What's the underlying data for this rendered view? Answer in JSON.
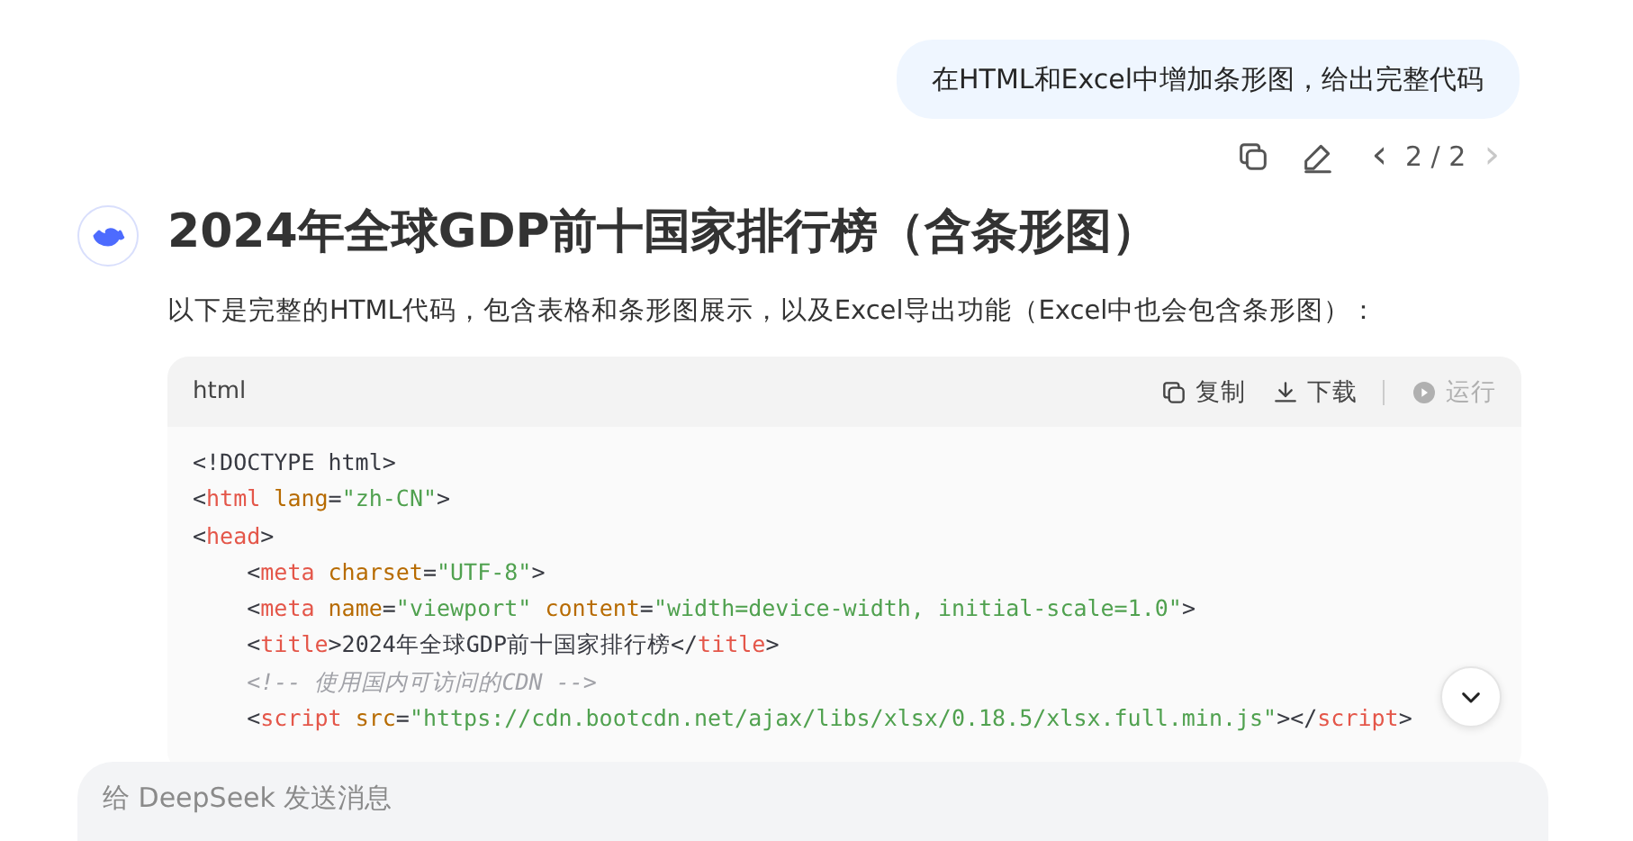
{
  "user_message": {
    "text": "在HTML和Excel中增加条形图，给出完整代码"
  },
  "message_actions": {
    "pager": {
      "prev": "‹",
      "current": "2 / 2",
      "next": "›",
      "prev_disabled": false,
      "next_disabled": true
    }
  },
  "answer": {
    "title": "2024年全球GDP前十国家排行榜（含条形图）",
    "intro": "以下是完整的HTML代码，包含表格和条形图展示，以及Excel导出功能（Excel中也会包含条形图）：",
    "code_block": {
      "language": "html",
      "actions": [
        {
          "kind": "copy",
          "label": "复制",
          "disabled": false
        },
        {
          "kind": "download",
          "label": "下载",
          "disabled": false
        },
        {
          "kind": "run",
          "label": "运行",
          "disabled": true
        }
      ],
      "lines": [
        [
          {
            "kind": "plain",
            "text": "<!DOCTYPE html>"
          }
        ],
        [
          {
            "kind": "plain",
            "text": "<"
          },
          {
            "kind": "tag",
            "text": "html"
          },
          {
            "kind": "attr",
            "text": " lang"
          },
          {
            "kind": "plain",
            "text": "="
          },
          {
            "kind": "string",
            "text": "\"zh-CN\""
          },
          {
            "kind": "plain",
            "text": ">"
          }
        ],
        [
          {
            "kind": "plain",
            "text": "<"
          },
          {
            "kind": "tag",
            "text": "head"
          },
          {
            "kind": "plain",
            "text": ">"
          }
        ],
        [
          {
            "kind": "plain",
            "text": "    <"
          },
          {
            "kind": "tag",
            "text": "meta"
          },
          {
            "kind": "attr",
            "text": " charset"
          },
          {
            "kind": "plain",
            "text": "="
          },
          {
            "kind": "string",
            "text": "\"UTF-8\""
          },
          {
            "kind": "plain",
            "text": ">"
          }
        ],
        [
          {
            "kind": "plain",
            "text": "    <"
          },
          {
            "kind": "tag",
            "text": "meta"
          },
          {
            "kind": "attr",
            "text": " name"
          },
          {
            "kind": "plain",
            "text": "="
          },
          {
            "kind": "string",
            "text": "\"viewport\""
          },
          {
            "kind": "attr",
            "text": " content"
          },
          {
            "kind": "plain",
            "text": "="
          },
          {
            "kind": "string",
            "text": "\"width=device-width, initial-scale=1.0\""
          },
          {
            "kind": "plain",
            "text": ">"
          }
        ],
        [
          {
            "kind": "plain",
            "text": "    <"
          },
          {
            "kind": "tag",
            "text": "title"
          },
          {
            "kind": "plain",
            "text": ">2024年全球GDP前十国家排行榜</"
          },
          {
            "kind": "tag",
            "text": "title"
          },
          {
            "kind": "plain",
            "text": ">"
          }
        ],
        [
          {
            "kind": "comment",
            "text": "    <!-- 使用国内可访问的CDN -->"
          }
        ],
        [
          {
            "kind": "plain",
            "text": "    <"
          },
          {
            "kind": "tag",
            "text": "script"
          },
          {
            "kind": "attr",
            "text": " src"
          },
          {
            "kind": "plain",
            "text": "="
          },
          {
            "kind": "string",
            "text": "\"https://cdn.bootcdn.net/ajax/libs/xlsx/0.18.5/xlsx.full.min.js\""
          },
          {
            "kind": "plain",
            "text": "></"
          },
          {
            "kind": "tag",
            "text": "script"
          },
          {
            "kind": "plain",
            "text": ">"
          }
        ]
      ]
    }
  },
  "composer": {
    "placeholder": "给 DeepSeek 发送消息"
  }
}
